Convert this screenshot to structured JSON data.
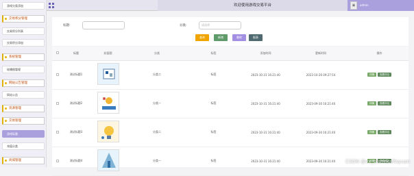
{
  "header": {
    "title": "欢迎使用游戏交易平台",
    "username": "admin",
    "grid_icon": "grid-icon",
    "avatar_icon": "avatar-icon",
    "accent": "#a9a0dd"
  },
  "sidebar": {
    "items": [
      {
        "type": "item",
        "label": "游戏分类添加"
      },
      {
        "type": "group",
        "label": "交易积分管理"
      },
      {
        "type": "item",
        "label": "交易积分列表"
      },
      {
        "type": "item",
        "label": "交易积分添加"
      },
      {
        "type": "group",
        "label": "系统管理"
      },
      {
        "type": "item",
        "label": "轮播图管理"
      },
      {
        "type": "group",
        "label": "网站公告管理"
      },
      {
        "type": "item",
        "label": "网站公告"
      },
      {
        "type": "group",
        "label": "资源管理"
      },
      {
        "type": "group",
        "label": "交易管理"
      },
      {
        "type": "item",
        "label": "游戏标题",
        "active": true
      },
      {
        "type": "item",
        "label": "充值分类"
      },
      {
        "type": "group",
        "label": "商城管理"
      }
    ]
  },
  "search": {
    "title_label": "标题:",
    "category_label": "分类:",
    "category_placeholder": "请选择",
    "buttons": {
      "search": "查询",
      "add": "新增",
      "delete": "删除",
      "report": "报表"
    }
  },
  "table": {
    "columns": [
      "",
      "标题",
      "封面图",
      "分类",
      "标签",
      "添加时间",
      "更新时间",
      "操作"
    ],
    "rows": [
      {
        "title": "测试标题1",
        "category": "分类二",
        "tag": "标签",
        "created": "2023-10-31 16:21:40",
        "updated": "2023-10-26 09:27:54"
      },
      {
        "title": "测试标题2",
        "category": "分类一",
        "tag": "标签",
        "created": "2023-10-31 16:21:40",
        "updated": "2023-09-30 16:21:40"
      },
      {
        "title": "测试标题3",
        "category": "分类二",
        "tag": "标签",
        "created": "2023-10-31 16:21:40",
        "updated": "2023-09-30 16:21:40"
      },
      {
        "title": "测试标题4",
        "category": "分类一",
        "tag": "标签",
        "created": "2023-10-31 16:21:40",
        "updated": "2023-09-30 16:21:40"
      }
    ],
    "actions": {
      "detail": "详情",
      "view": "查看评论"
    }
  },
  "watermark": "CSDN @vx_bishekaifayuan"
}
